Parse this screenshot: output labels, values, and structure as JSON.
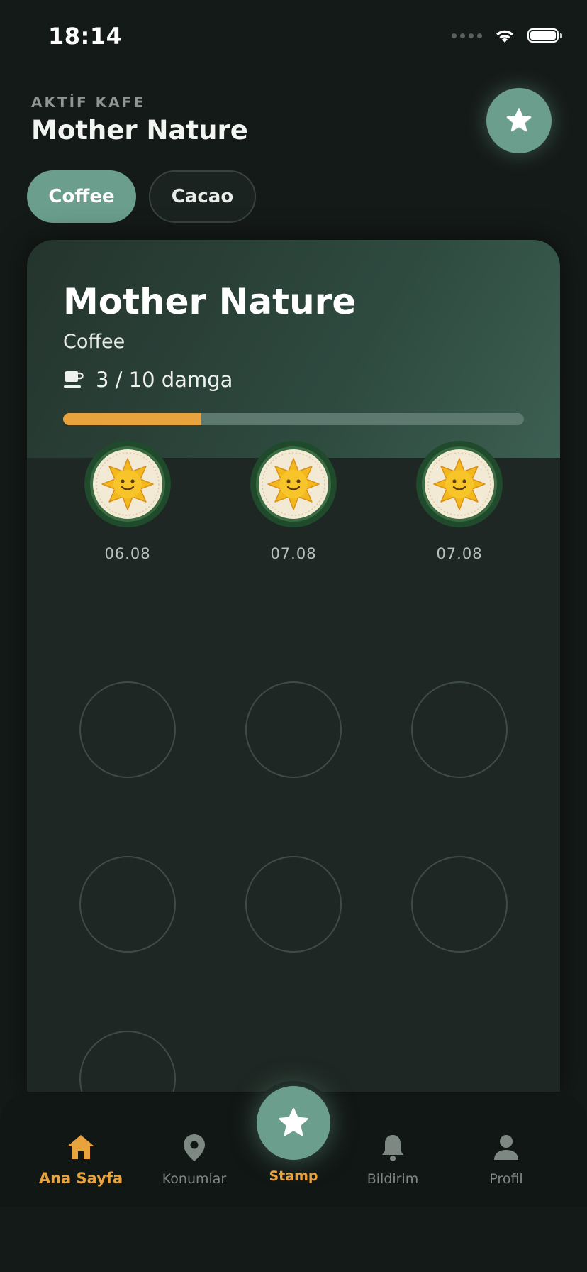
{
  "status_bar": {
    "time": "18:14"
  },
  "header": {
    "label": "AKTİF KAFE",
    "title": "Mother Nature"
  },
  "chips": {
    "active": "Coffee",
    "inactive": "Cacao"
  },
  "card": {
    "title": "Mother Nature",
    "subtitle": "Coffee",
    "stamp_text": "3 / 10 damga",
    "progress": 0.3
  },
  "stamps": [
    {
      "filled": true,
      "date": "06.08"
    },
    {
      "filled": true,
      "date": "07.08"
    },
    {
      "filled": true,
      "date": "07.08"
    },
    {
      "filled": false,
      "date": ""
    },
    {
      "filled": false,
      "date": ""
    },
    {
      "filled": false,
      "date": ""
    },
    {
      "filled": false,
      "date": ""
    },
    {
      "filled": false,
      "date": ""
    },
    {
      "filled": false,
      "date": ""
    },
    {
      "filled": false,
      "date": ""
    }
  ],
  "nav": {
    "home": "Ana Sayfa",
    "locations": "Konumlar",
    "stamp": "Stamp",
    "notifications": "Bildirim",
    "profile": "Profil"
  },
  "colors": {
    "accent": "#6b9e8c",
    "highlight": "#e8a33c",
    "background": "#141a18"
  }
}
